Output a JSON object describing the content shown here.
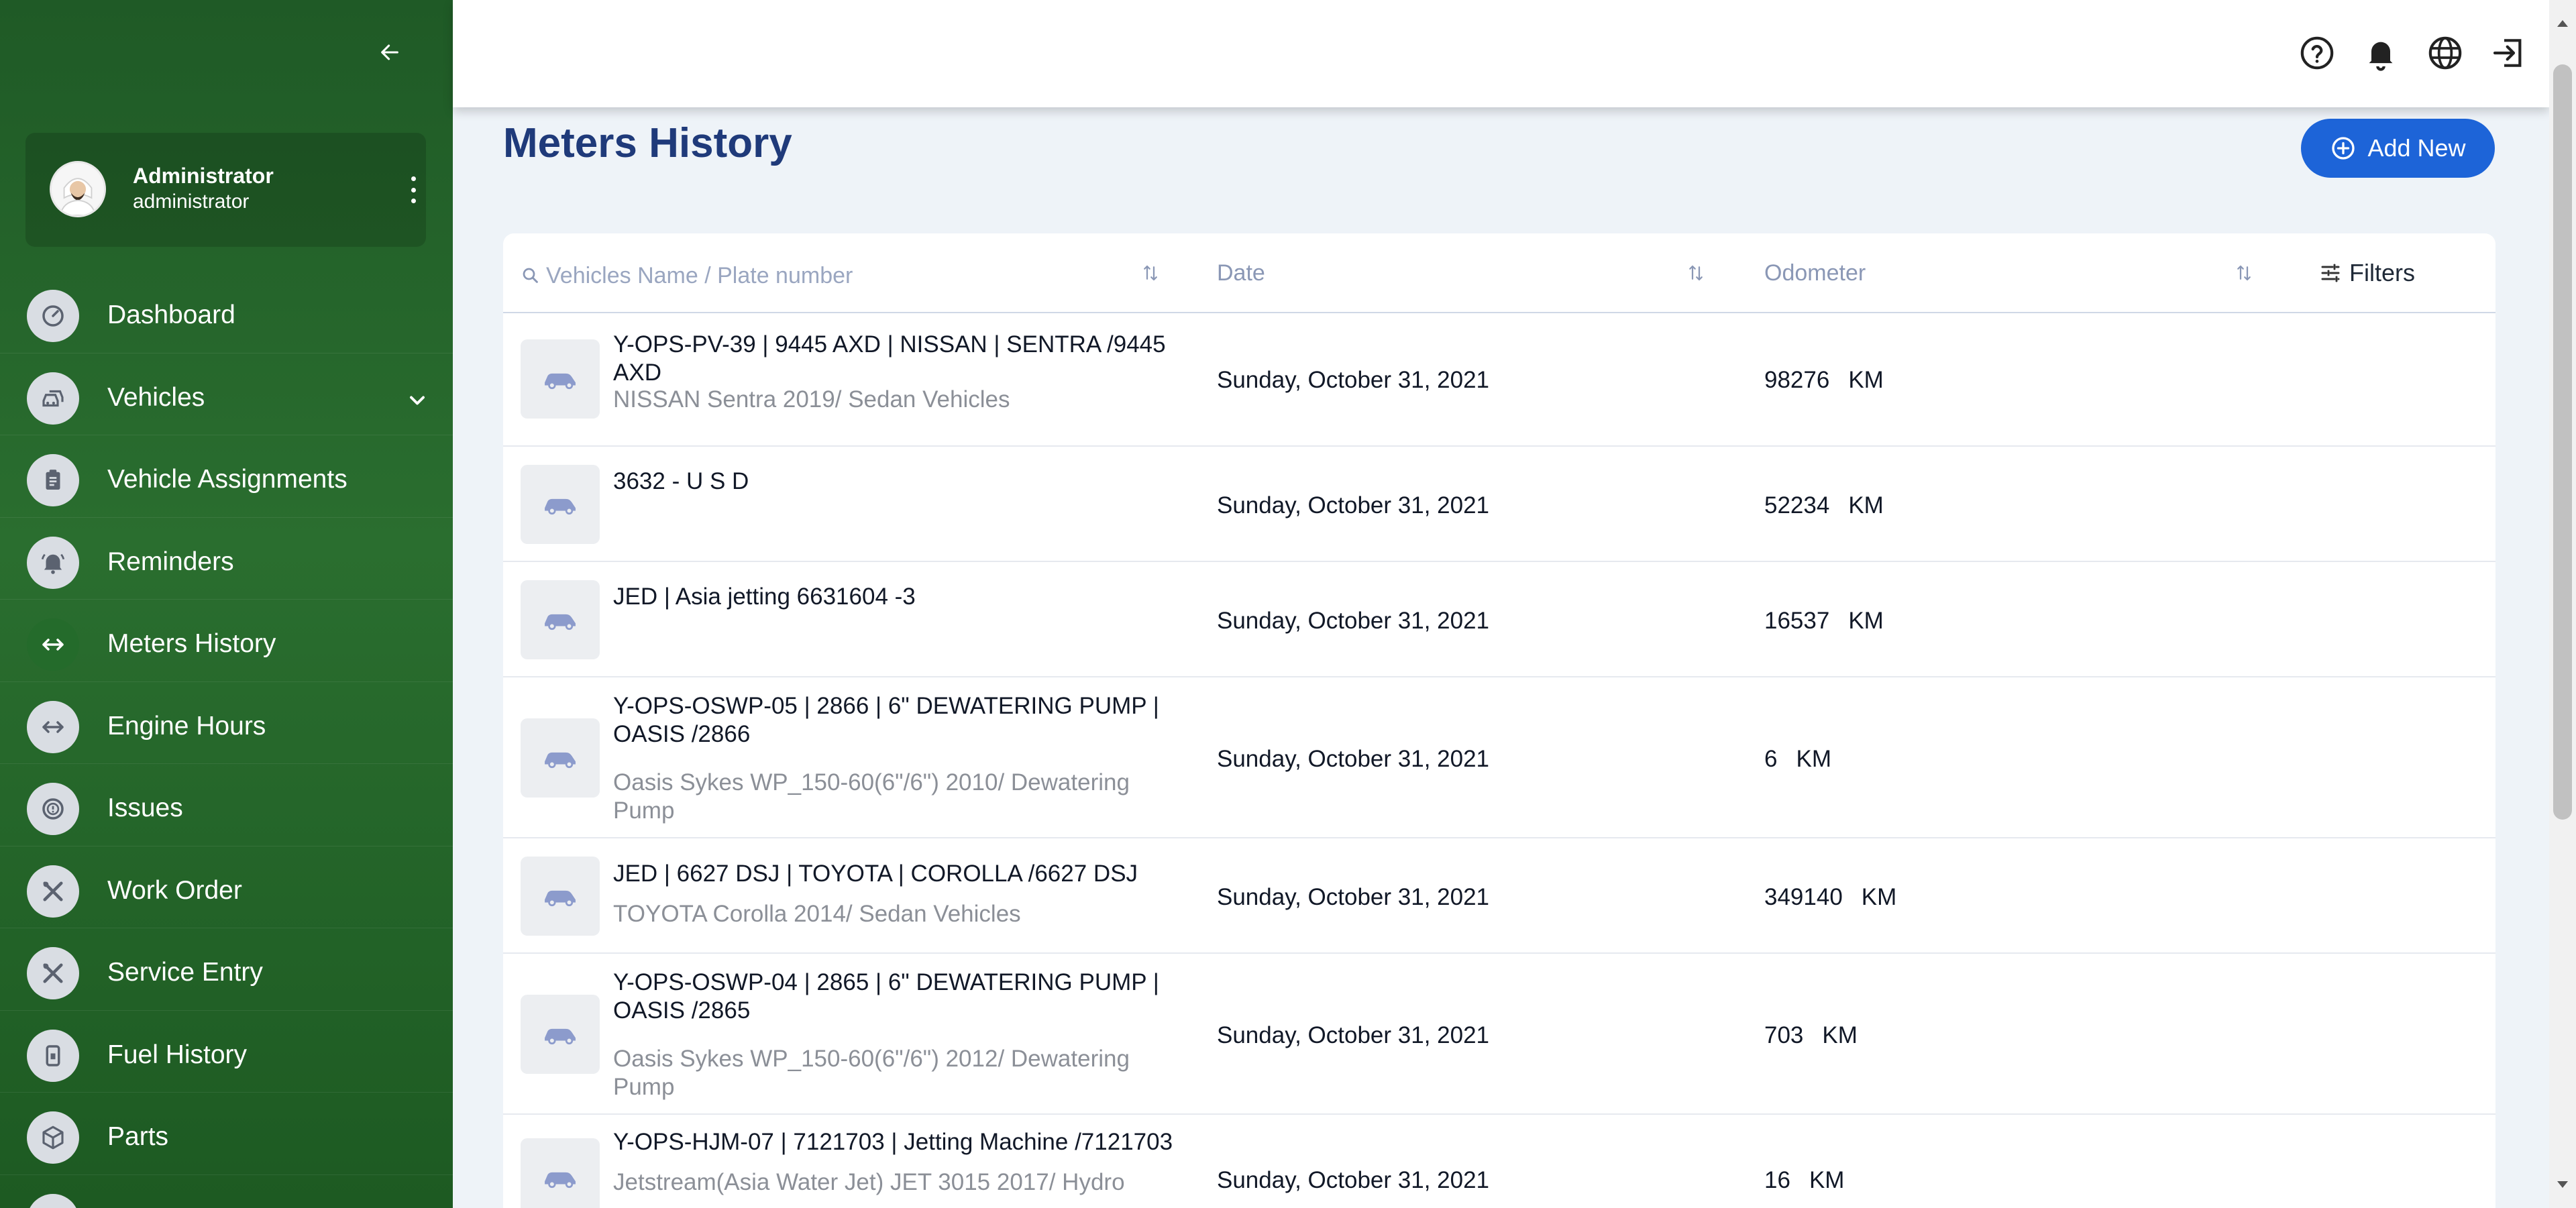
{
  "sidebar": {
    "user": {
      "name": "Administrator",
      "role": "administrator"
    },
    "items": [
      {
        "label": "Dashboard",
        "icon": "speedometer-icon"
      },
      {
        "label": "Vehicles",
        "icon": "vehicles-icon",
        "expandable": true
      },
      {
        "label": "Vehicle Assignments",
        "icon": "clipboard-icon"
      },
      {
        "label": "Reminders",
        "icon": "bell-ring-icon"
      },
      {
        "label": "Meters History",
        "icon": "horizontal-arrows-icon",
        "active": true
      },
      {
        "label": "Engine Hours",
        "icon": "horizontal-arrows-icon"
      },
      {
        "label": "Issues",
        "icon": "alert-circle-icon"
      },
      {
        "label": "Work Order",
        "icon": "tools-icon"
      },
      {
        "label": "Service Entry",
        "icon": "tools-icon"
      },
      {
        "label": "Fuel History",
        "icon": "fuel-icon"
      },
      {
        "label": "Parts",
        "icon": "cube-icon"
      }
    ]
  },
  "header": {
    "icons": [
      "help-icon",
      "notification-bell-icon",
      "globe-icon",
      "logout-icon"
    ]
  },
  "page": {
    "title": "Meters History",
    "add_button_label": "Add New"
  },
  "table": {
    "search_placeholder": "Vehicles Name / Plate number",
    "columns": {
      "date": "Date",
      "odometer": "Odometer"
    },
    "filters_label": "Filters",
    "rows": [
      {
        "name": "Y-OPS-PV-39 | 9445 AXD | NISSAN | SENTRA /9445 AXD",
        "sub": "NISSAN Sentra 2019/ Sedan Vehicles",
        "date": "Sunday, October 31, 2021",
        "odometer": "98276",
        "unit": "KM"
      },
      {
        "name": "3632 - U S D",
        "sub": "",
        "date": "Sunday, October 31, 2021",
        "odometer": "52234",
        "unit": "KM"
      },
      {
        "name": "JED | Asia jetting 6631604 -3",
        "sub": "",
        "date": "Sunday, October 31, 2021",
        "odometer": "16537",
        "unit": "KM"
      },
      {
        "name": "Y-OPS-OSWP-05 | 2866 | 6\" DEWATERING PUMP | OASIS /2866",
        "sub": "Oasis Sykes WP_150-60(6\"/6\") 2010/ Dewatering Pump",
        "date": "Sunday, October 31, 2021",
        "odometer": "6",
        "unit": "KM"
      },
      {
        "name": "JED | 6627 DSJ | TOYOTA | COROLLA /6627 DSJ",
        "sub": "TOYOTA Corolla 2014/ Sedan Vehicles",
        "date": "Sunday, October 31, 2021",
        "odometer": "349140",
        "unit": "KM"
      },
      {
        "name": "Y-OPS-OSWP-04 | 2865 | 6\" DEWATERING PUMP | OASIS /2865",
        "sub": "Oasis Sykes WP_150-60(6\"/6\") 2012/ Dewatering Pump",
        "date": "Sunday, October 31, 2021",
        "odometer": "703",
        "unit": "KM"
      },
      {
        "name": "Y-OPS-HJM-07 | 7121703 | Jetting Machine /7121703",
        "sub": "Jetstream(Asia Water Jet) JET 3015 2017/ Hydro",
        "date": "Sunday, October 31, 2021",
        "odometer": "16",
        "unit": "KM"
      }
    ]
  },
  "colors": {
    "sidebar_green": "#2a6e2f",
    "title_blue": "#1f3a7a",
    "primary_button": "#1d64d8"
  }
}
